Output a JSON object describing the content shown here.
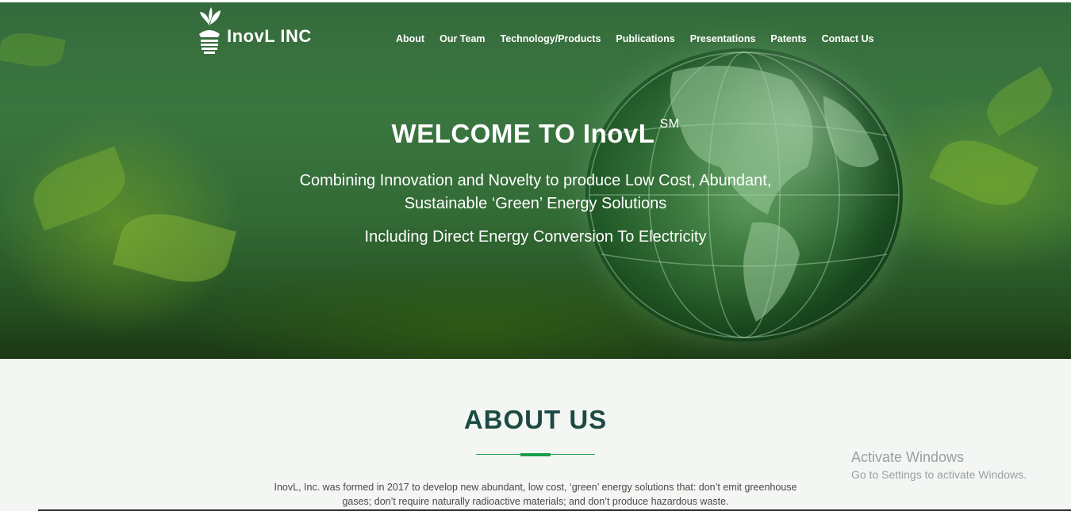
{
  "brand": {
    "name": "InovL INC"
  },
  "nav": {
    "items": [
      {
        "label": "About"
      },
      {
        "label": "Our Team"
      },
      {
        "label": "Technology/Products"
      },
      {
        "label": "Publications"
      },
      {
        "label": "Presentations"
      },
      {
        "label": "Patents"
      },
      {
        "label": "Contact Us"
      }
    ]
  },
  "hero": {
    "title": "WELCOME TO InovL",
    "title_sup": "SM",
    "subtitle": "Combining Innovation and Novelty to produce Low Cost, Abundant, Sustainable ‘Green’ Energy Solutions",
    "subtitle2": "Including Direct Energy Conversion To Electricity"
  },
  "about": {
    "title": "ABOUT US",
    "text": "InovL, Inc. was formed in 2017 to develop new abundant, low cost, ‘green’ energy solutions that: don’t emit greenhouse gases; don’t require naturally radioactive materials; and don’t produce hazardous waste."
  },
  "watermark": {
    "title": "Activate Windows",
    "subtitle": "Go to Settings to activate Windows."
  },
  "colors": {
    "heading": "#1b4a43",
    "accent": "#17a047",
    "hero_text": "#ffffff"
  }
}
